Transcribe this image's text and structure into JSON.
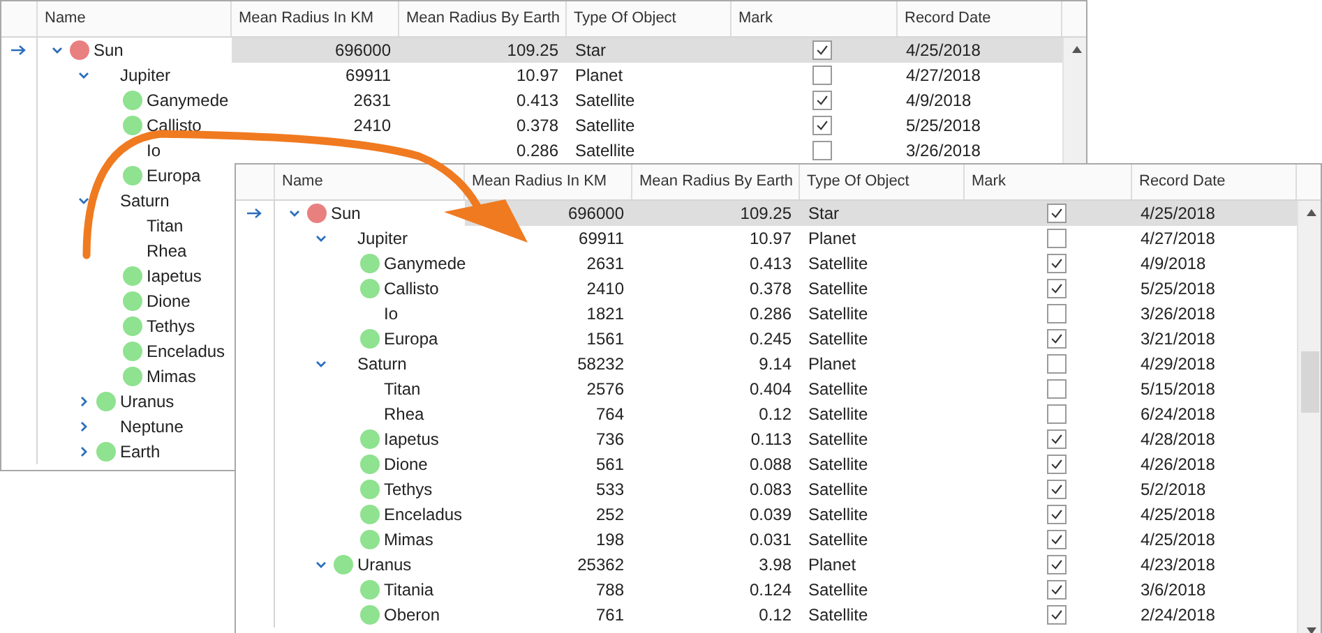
{
  "windows": [
    {
      "columns": [
        "Name",
        "Mean Radius In KM",
        "Mean Radius By Earth",
        "Type Of Object",
        "Mark",
        "Record Date"
      ],
      "rows": [
        {
          "name": "Sun",
          "color": "#e98080",
          "expanded": true,
          "selected": true,
          "km": "696000",
          "earth": "109.25",
          "type": "Star",
          "checked": true,
          "date": "4/25/2018",
          "children": [
            {
              "name": "Jupiter",
              "expanded": true,
              "selected": false,
              "km": "69911",
              "earth": "10.97",
              "type": "Planet",
              "checked": false,
              "date": "4/27/2018",
              "children": [
                {
                  "name": "Ganymede",
                  "color": "#8fe28f",
                  "selected": false,
                  "km": "2631",
                  "earth": "0.413",
                  "type": "Satellite",
                  "checked": true,
                  "date": "4/9/2018"
                },
                {
                  "name": "Callisto",
                  "color": "#8fe28f",
                  "selected": false,
                  "km": "2410",
                  "earth": "0.378",
                  "type": "Satellite",
                  "checked": true,
                  "date": "5/25/2018"
                },
                {
                  "name": "Io",
                  "selected": false,
                  "earth": "0.286",
                  "type": "Satellite",
                  "checked": false,
                  "date": "3/26/2018"
                },
                {
                  "name": "Europa",
                  "color": "#8fe28f",
                  "selected": false
                }
              ]
            },
            {
              "name": "Saturn",
              "expanded": true,
              "selected": false,
              "children": [
                {
                  "name": "Titan",
                  "selected": false
                },
                {
                  "name": "Rhea",
                  "selected": false
                },
                {
                  "name": "Iapetus",
                  "color": "#8fe28f",
                  "selected": false
                },
                {
                  "name": "Dione",
                  "color": "#8fe28f",
                  "selected": false
                },
                {
                  "name": "Tethys",
                  "color": "#8fe28f",
                  "selected": false
                },
                {
                  "name": "Enceladus",
                  "color": "#8fe28f",
                  "selected": false
                },
                {
                  "name": "Mimas",
                  "color": "#8fe28f",
                  "selected": false
                }
              ]
            },
            {
              "name": "Uranus",
              "color": "#8fe28f",
              "expanded": false,
              "selected": false
            },
            {
              "name": "Neptune",
              "expanded": false,
              "selected": false
            },
            {
              "name": "Earth",
              "color": "#8fe28f",
              "expanded": false,
              "selected": false
            }
          ]
        }
      ]
    },
    {
      "columns": [
        "Name",
        "Mean Radius In KM",
        "Mean Radius By Earth",
        "Type Of Object",
        "Mark",
        "Record Date"
      ],
      "rows": [
        {
          "name": "Sun",
          "color": "#e98080",
          "expanded": true,
          "selected": true,
          "km": "696000",
          "earth": "109.25",
          "type": "Star",
          "checked": true,
          "date": "4/25/2018",
          "children": [
            {
              "name": "Jupiter",
              "expanded": true,
              "selected": false,
              "km": "69911",
              "earth": "10.97",
              "type": "Planet",
              "checked": false,
              "date": "4/27/2018",
              "children": [
                {
                  "name": "Ganymede",
                  "color": "#8fe28f",
                  "selected": false,
                  "km": "2631",
                  "earth": "0.413",
                  "type": "Satellite",
                  "checked": true,
                  "date": "4/9/2018"
                },
                {
                  "name": "Callisto",
                  "color": "#8fe28f",
                  "selected": false,
                  "km": "2410",
                  "earth": "0.378",
                  "type": "Satellite",
                  "checked": true,
                  "date": "5/25/2018"
                },
                {
                  "name": "Io",
                  "selected": false,
                  "km": "1821",
                  "earth": "0.286",
                  "type": "Satellite",
                  "checked": false,
                  "date": "3/26/2018"
                },
                {
                  "name": "Europa",
                  "color": "#8fe28f",
                  "selected": false,
                  "km": "1561",
                  "earth": "0.245",
                  "type": "Satellite",
                  "checked": true,
                  "date": "3/21/2018"
                }
              ]
            },
            {
              "name": "Saturn",
              "expanded": true,
              "selected": false,
              "km": "58232",
              "earth": "9.14",
              "type": "Planet",
              "checked": false,
              "date": "4/29/2018",
              "children": [
                {
                  "name": "Titan",
                  "selected": false,
                  "km": "2576",
                  "earth": "0.404",
                  "type": "Satellite",
                  "checked": false,
                  "date": "5/15/2018"
                },
                {
                  "name": "Rhea",
                  "selected": false,
                  "km": "764",
                  "earth": "0.12",
                  "type": "Satellite",
                  "checked": false,
                  "date": "6/24/2018"
                },
                {
                  "name": "Iapetus",
                  "color": "#8fe28f",
                  "selected": false,
                  "km": "736",
                  "earth": "0.113",
                  "type": "Satellite",
                  "checked": true,
                  "date": "4/28/2018"
                },
                {
                  "name": "Dione",
                  "color": "#8fe28f",
                  "selected": false,
                  "km": "561",
                  "earth": "0.088",
                  "type": "Satellite",
                  "checked": true,
                  "date": "4/26/2018"
                },
                {
                  "name": "Tethys",
                  "color": "#8fe28f",
                  "selected": false,
                  "km": "533",
                  "earth": "0.083",
                  "type": "Satellite",
                  "checked": true,
                  "date": "5/2/2018"
                },
                {
                  "name": "Enceladus",
                  "color": "#8fe28f",
                  "selected": false,
                  "km": "252",
                  "earth": "0.039",
                  "type": "Satellite",
                  "checked": true,
                  "date": "4/25/2018"
                },
                {
                  "name": "Mimas",
                  "color": "#8fe28f",
                  "selected": false,
                  "km": "198",
                  "earth": "0.031",
                  "type": "Satellite",
                  "checked": true,
                  "date": "4/25/2018"
                }
              ]
            },
            {
              "name": "Uranus",
              "color": "#8fe28f",
              "expanded": true,
              "selected": false,
              "km": "25362",
              "earth": "3.98",
              "type": "Planet",
              "checked": true,
              "date": "4/23/2018",
              "children": [
                {
                  "name": "Titania",
                  "color": "#8fe28f",
                  "selected": false,
                  "km": "788",
                  "earth": "0.124",
                  "type": "Satellite",
                  "checked": true,
                  "date": "3/6/2018"
                },
                {
                  "name": "Oberon",
                  "color": "#8fe28f",
                  "selected": false,
                  "km": "761",
                  "earth": "0.12",
                  "type": "Satellite",
                  "checked": true,
                  "date": "2/24/2018"
                }
              ]
            }
          ]
        }
      ]
    }
  ]
}
